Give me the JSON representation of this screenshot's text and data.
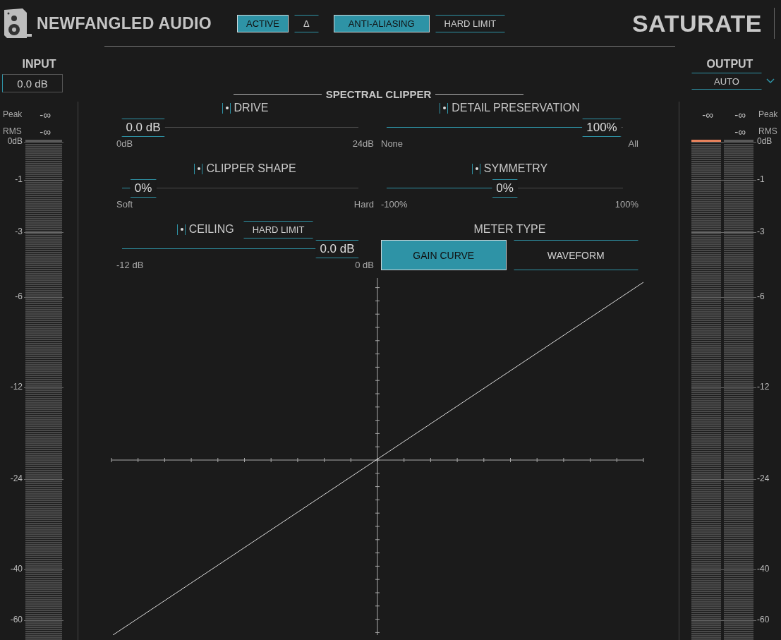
{
  "header": {
    "brand": "NEWFANGLED AUDIO",
    "buttons": [
      {
        "label": "ACTIVE",
        "on": true
      },
      {
        "label": "Δ",
        "on": false
      },
      {
        "label": "ANTI-ALIASING",
        "on": true
      },
      {
        "label": "HARD LIMIT",
        "on": false
      }
    ],
    "product": "SATURATE"
  },
  "input": {
    "title": "INPUT",
    "value": "0.0 dB",
    "readouts": [
      {
        "label": "Peak",
        "values": [
          "-∞"
        ]
      },
      {
        "label": "RMS",
        "values": [
          "-∞"
        ]
      }
    ],
    "meters": [
      {
        "clipped": false
      }
    ],
    "scale": [
      "0dB",
      "-1",
      "-3",
      "-6",
      "-12",
      "-24",
      "-40",
      "-60"
    ]
  },
  "section_title": "SPECTRAL CLIPPER",
  "controls": [
    {
      "kind": "slider",
      "label": "DRIVE",
      "on": true,
      "value": "0.0 dB",
      "min": "0dB",
      "max": "24dB",
      "level": 0
    },
    {
      "kind": "slider",
      "label": "DETAIL PRESERVATION",
      "on": true,
      "value": "100%",
      "min": "None",
      "max": "All",
      "level": 1
    },
    {
      "kind": "slider",
      "label": "CLIPPER SHAPE",
      "on": true,
      "value": "0%",
      "min": "Soft",
      "max": "Hard",
      "level": 0
    },
    {
      "kind": "slider",
      "label": "SYMMETRY",
      "on": true,
      "value": "0%",
      "min": "-100%",
      "max": "100%",
      "level": 0.5
    },
    {
      "kind": "slider",
      "label": "CEILING",
      "on": true,
      "badge": {
        "label": "HARD LIMIT",
        "on": false
      },
      "value": "0.0 dB",
      "min": "-12 dB",
      "max": "0 dB",
      "level": 1
    },
    {
      "kind": "choice",
      "label": "METER TYPE",
      "options": [
        {
          "label": "GAIN CURVE",
          "selected": true
        },
        {
          "label": "WAVEFORM",
          "selected": false
        }
      ]
    }
  ],
  "output": {
    "title": "OUTPUT",
    "mode": "AUTO",
    "readouts": [
      {
        "label": "Peak",
        "values": [
          "-∞",
          "-∞"
        ]
      },
      {
        "label": "RMS",
        "values": [
          "-∞"
        ]
      }
    ],
    "meters": [
      {
        "clipped": true
      },
      {
        "clipped": false
      }
    ],
    "scale": [
      "0dB",
      "-1",
      "-3",
      "-6",
      "-12",
      "-24",
      "-40",
      "-60"
    ]
  }
}
